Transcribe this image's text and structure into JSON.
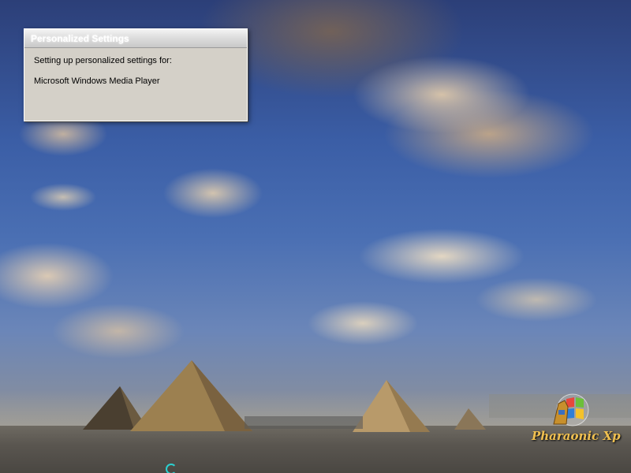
{
  "dialog": {
    "title": "Personalized Settings",
    "line1": "Setting up personalized settings for:",
    "line2": "Microsoft Windows Media Player"
  },
  "logo": {
    "text": "Pharaonic Xp",
    "icon": "windows-flag-sphinx-logo"
  },
  "cursor": {
    "icon": "busy-spinner-icon"
  },
  "colors": {
    "dialog_bg": "#d4d0c8",
    "logo_gold": "#f0c050"
  }
}
